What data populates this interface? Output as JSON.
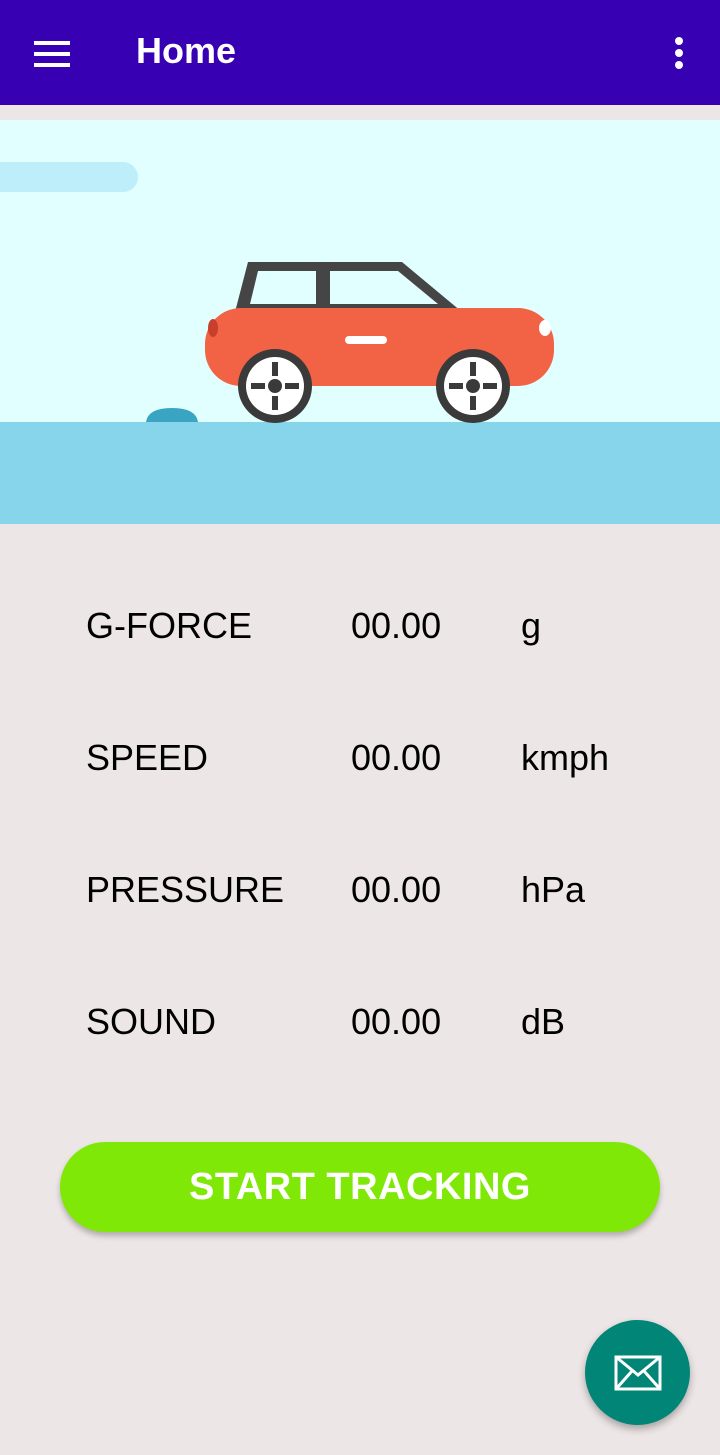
{
  "appbar": {
    "title": "Home",
    "menu_icon": "menu-icon",
    "more_icon": "more-vert-icon",
    "background": "#3700b3"
  },
  "hero": {
    "illustration": "car-icon",
    "sky_color": "#e0fffe",
    "ground_color": "#87d5ea",
    "car_color": "#f26244"
  },
  "stats": [
    {
      "label": "G-FORCE",
      "value": "00.00",
      "unit": "g"
    },
    {
      "label": "SPEED",
      "value": "00.00",
      "unit": "kmph"
    },
    {
      "label": "PRESSURE",
      "value": "00.00",
      "unit": "hPa"
    },
    {
      "label": "SOUND",
      "value": "00.00",
      "unit": "dB"
    }
  ],
  "start_button": {
    "label": "START TRACKING",
    "color": "#80e806"
  },
  "fab": {
    "icon": "mail-icon",
    "color": "#018577"
  }
}
